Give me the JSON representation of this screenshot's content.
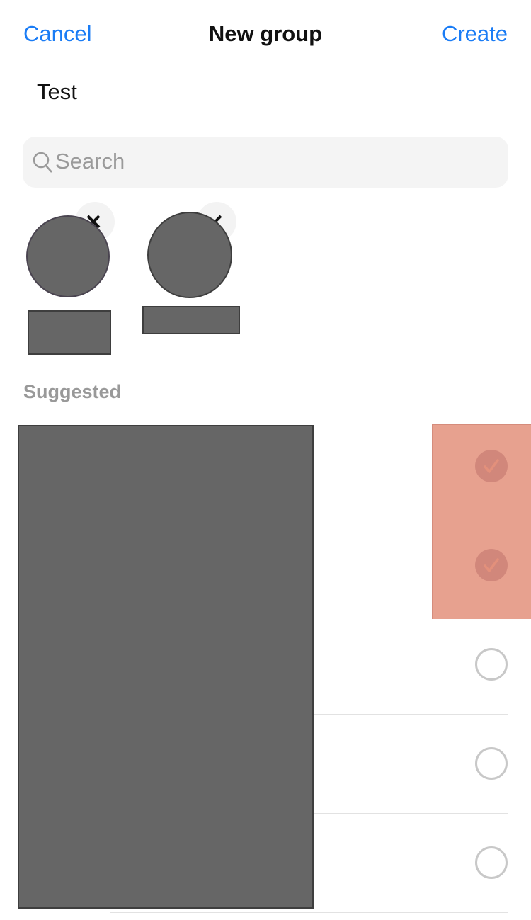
{
  "header": {
    "cancel_label": "Cancel",
    "title": "New group",
    "create_label": "Create"
  },
  "group_name": "Test",
  "search": {
    "placeholder": "Search",
    "icon": "search-icon"
  },
  "selected_members": [
    {
      "avatar": "redacted",
      "name": "redacted",
      "remove_icon": "close-icon"
    },
    {
      "avatar": "redacted",
      "name": "redacted",
      "remove_icon": "close-icon"
    }
  ],
  "suggested": {
    "label": "Suggested",
    "items": [
      {
        "name": "redacted",
        "selected": true
      },
      {
        "name": "redacted",
        "selected": true
      },
      {
        "name": "redacted",
        "selected": false
      },
      {
        "name": "redacted",
        "selected": false
      },
      {
        "name": "redacted",
        "selected": false
      }
    ]
  },
  "colors": {
    "accent": "#1a7cf5",
    "checked": "#877090",
    "highlight_overlay": "#e8a08e",
    "redaction": "#666666"
  }
}
